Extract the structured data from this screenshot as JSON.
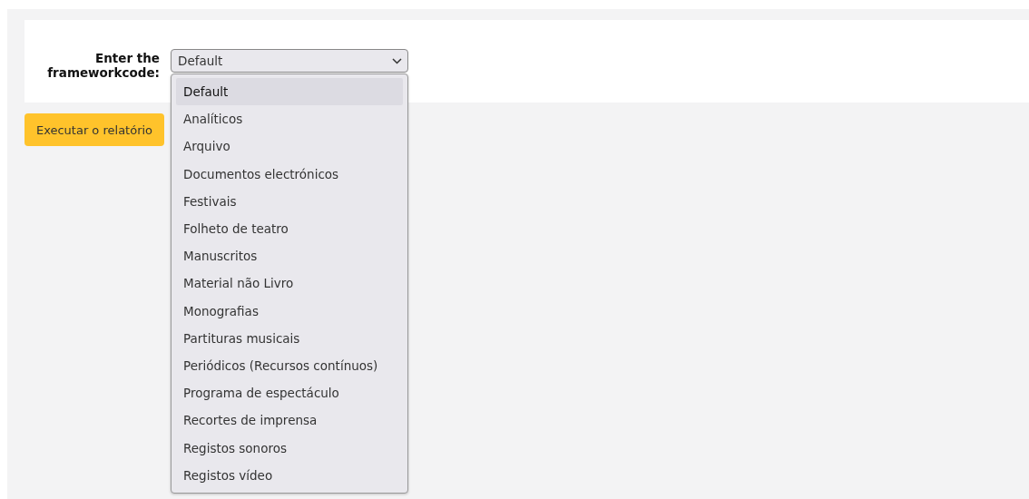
{
  "form": {
    "label": "Enter the frameworkcode:",
    "select": {
      "value": "Default",
      "expanded": true,
      "options": [
        {
          "label": "Default",
          "selected": true
        },
        {
          "label": "Analíticos",
          "selected": false
        },
        {
          "label": "Arquivo",
          "selected": false
        },
        {
          "label": "Documentos electrónicos",
          "selected": false
        },
        {
          "label": "Festivais",
          "selected": false
        },
        {
          "label": "Folheto de teatro",
          "selected": false
        },
        {
          "label": "Manuscritos",
          "selected": false
        },
        {
          "label": "Material não Livro",
          "selected": false
        },
        {
          "label": "Monografias",
          "selected": false
        },
        {
          "label": "Partituras musicais",
          "selected": false
        },
        {
          "label": "Periódicos (Recursos contínuos)",
          "selected": false
        },
        {
          "label": "Programa de espectáculo",
          "selected": false
        },
        {
          "label": "Recortes de imprensa",
          "selected": false
        },
        {
          "label": "Registos sonoros",
          "selected": false
        },
        {
          "label": "Registos vídeo",
          "selected": false
        }
      ]
    }
  },
  "run_button": "Executar o relatório"
}
